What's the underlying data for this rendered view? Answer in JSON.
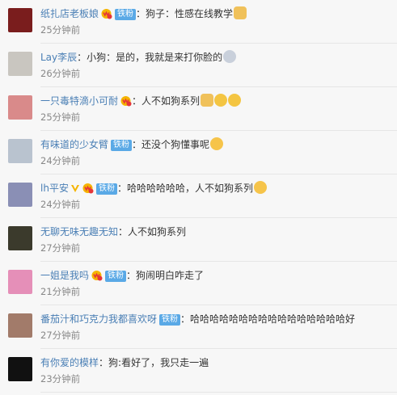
{
  "comments": [
    {
      "user": "纸扎店老板娘",
      "vip": true,
      "badge": "铁粉",
      "verified": false,
      "sep": "：",
      "text": "狗子：性感在线教学",
      "emojis": [
        "dog-face-emoji"
      ],
      "time": "25分钟前",
      "avatar_color": "#7a1d1d"
    },
    {
      "user": "Lay李辰",
      "vip": false,
      "badge": "",
      "verified": false,
      "sep": "：",
      "text": "小狗：是的，我就是来打你脸的",
      "emojis": [
        "blink-face-emoji"
      ],
      "time": "26分钟前",
      "avatar_color": "#c9c6c0"
    },
    {
      "user": "一只毒特滴小可耐",
      "vip": true,
      "badge": "",
      "verified": false,
      "sep": "：",
      "text": "人不如狗系列",
      "emojis": [
        "dog-face-emoji",
        "laugh-cry-emoji",
        "laugh-cry-emoji"
      ],
      "time": "25分钟前",
      "avatar_color": "#d98a8a"
    },
    {
      "user": "有味道的少女臂",
      "vip": false,
      "badge": "铁粉",
      "verified": false,
      "sep": "：",
      "text": "还没个狗懂事呢",
      "emojis": [
        "laugh-emoji"
      ],
      "time": "24分钟前",
      "avatar_color": "#b9c3cf"
    },
    {
      "user": "lh平安",
      "vip": true,
      "badge": "铁粉",
      "verified": true,
      "sep": "：",
      "text": "哈哈哈哈哈哈，人不如狗系列",
      "emojis": [
        "laugh-emoji"
      ],
      "time": "24分钟前",
      "avatar_color": "#8a8fb5"
    },
    {
      "user": "无聊无味无趣无知",
      "vip": false,
      "badge": "",
      "verified": false,
      "sep": "：",
      "text": "人不如狗系列",
      "emojis": [],
      "time": "27分钟前",
      "avatar_color": "#3b3a2c"
    },
    {
      "user": "一姐是我吗",
      "vip": true,
      "badge": "铁粉",
      "verified": false,
      "sep": "：",
      "text": "狗闹明白咋走了",
      "emojis": [],
      "time": "21分钟前",
      "avatar_color": "#e58fb8"
    },
    {
      "user": "番茄汁和巧克力我都喜欢呀",
      "vip": false,
      "badge": "铁粉",
      "verified": false,
      "sep": "：",
      "text": "哈哈哈哈哈哈哈哈哈哈哈哈哈哈哈哈好",
      "emojis": [],
      "time": "27分钟前",
      "avatar_color": "#a27b6a"
    },
    {
      "user": "有你爱的模样",
      "vip": false,
      "badge": "",
      "verified": false,
      "sep": "：",
      "text": "狗:看好了，我只走一遍",
      "emojis": [],
      "time": "23分钟前",
      "avatar_color": "#111111"
    }
  ]
}
